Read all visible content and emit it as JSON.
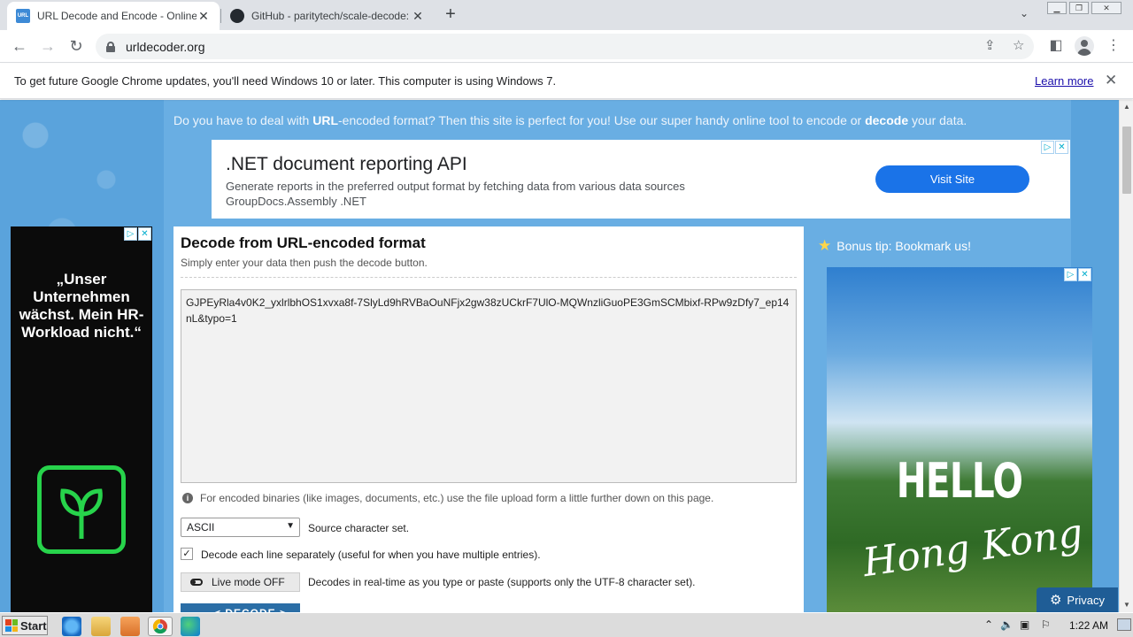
{
  "browser": {
    "tabs": [
      {
        "title": "URL Decode and Encode - Online",
        "favicon": "URL",
        "active": true
      },
      {
        "title": "GitHub - paritytech/scale-decode: De",
        "favicon": "github-icon",
        "active": false
      }
    ],
    "url": "urldecoder.org",
    "infobar": {
      "message": "To get future Google Chrome updates, you'll need Windows 10 or later. This computer is using Windows 7.",
      "link": "Learn more"
    }
  },
  "page": {
    "tagline_prefix": "Do you have to deal with ",
    "tagline_bold1": "URL",
    "tagline_mid": "-encoded format? Then this site is perfect for you! Use our super handy online tool to encode or ",
    "tagline_bold2": "decode",
    "tagline_suffix": " your data.",
    "top_ad": {
      "title": ".NET document reporting API",
      "line1": "Generate reports in the preferred output format by fetching data from various data sources",
      "line2": "GroupDocs.Assembly .NET",
      "button": "Visit Site"
    },
    "left_ad": {
      "slogan": "„Unser Unternehmen wächst. Mein HR-Workload nicht.“"
    },
    "decoder": {
      "title": "Decode from URL-encoded format",
      "subtitle": "Simply enter your data then push the decode button.",
      "input_value": "GJPEyRla4v0K2_yxlrlbhOS1xvxa8f-7SlyLd9hRVBaOuNFjx2gw38zUCkrF7UlO-MQWnzliGuoPE3GmSCMbixf-RPw9zDfy7_ep14nL&typo=1",
      "info": "For encoded binaries (like images, documents, etc.) use the file upload form a little further down on this page.",
      "charset_value": "ASCII",
      "charset_label": "Source character set.",
      "each_line_label": "Decode each line separately (useful for when you have multiple entries).",
      "each_line_checked": true,
      "live_mode_button": "Live mode OFF",
      "live_mode_label": "Decodes in real-time as you type or paste (supports only the UTF-8 character set).",
      "decode_button": "< DECODE >"
    },
    "bonus_tip": "Bonus tip: Bookmark us!",
    "right_ad": {
      "line1": "HELLO",
      "line2": "Hong Kong"
    },
    "privacy": "Privacy"
  },
  "taskbar": {
    "start": "Start",
    "time": "1:22 AM"
  },
  "colors": {
    "page_bg": "#69aee3",
    "visit_button": "#1a73e8",
    "decode_button": "#2b6ea6"
  }
}
